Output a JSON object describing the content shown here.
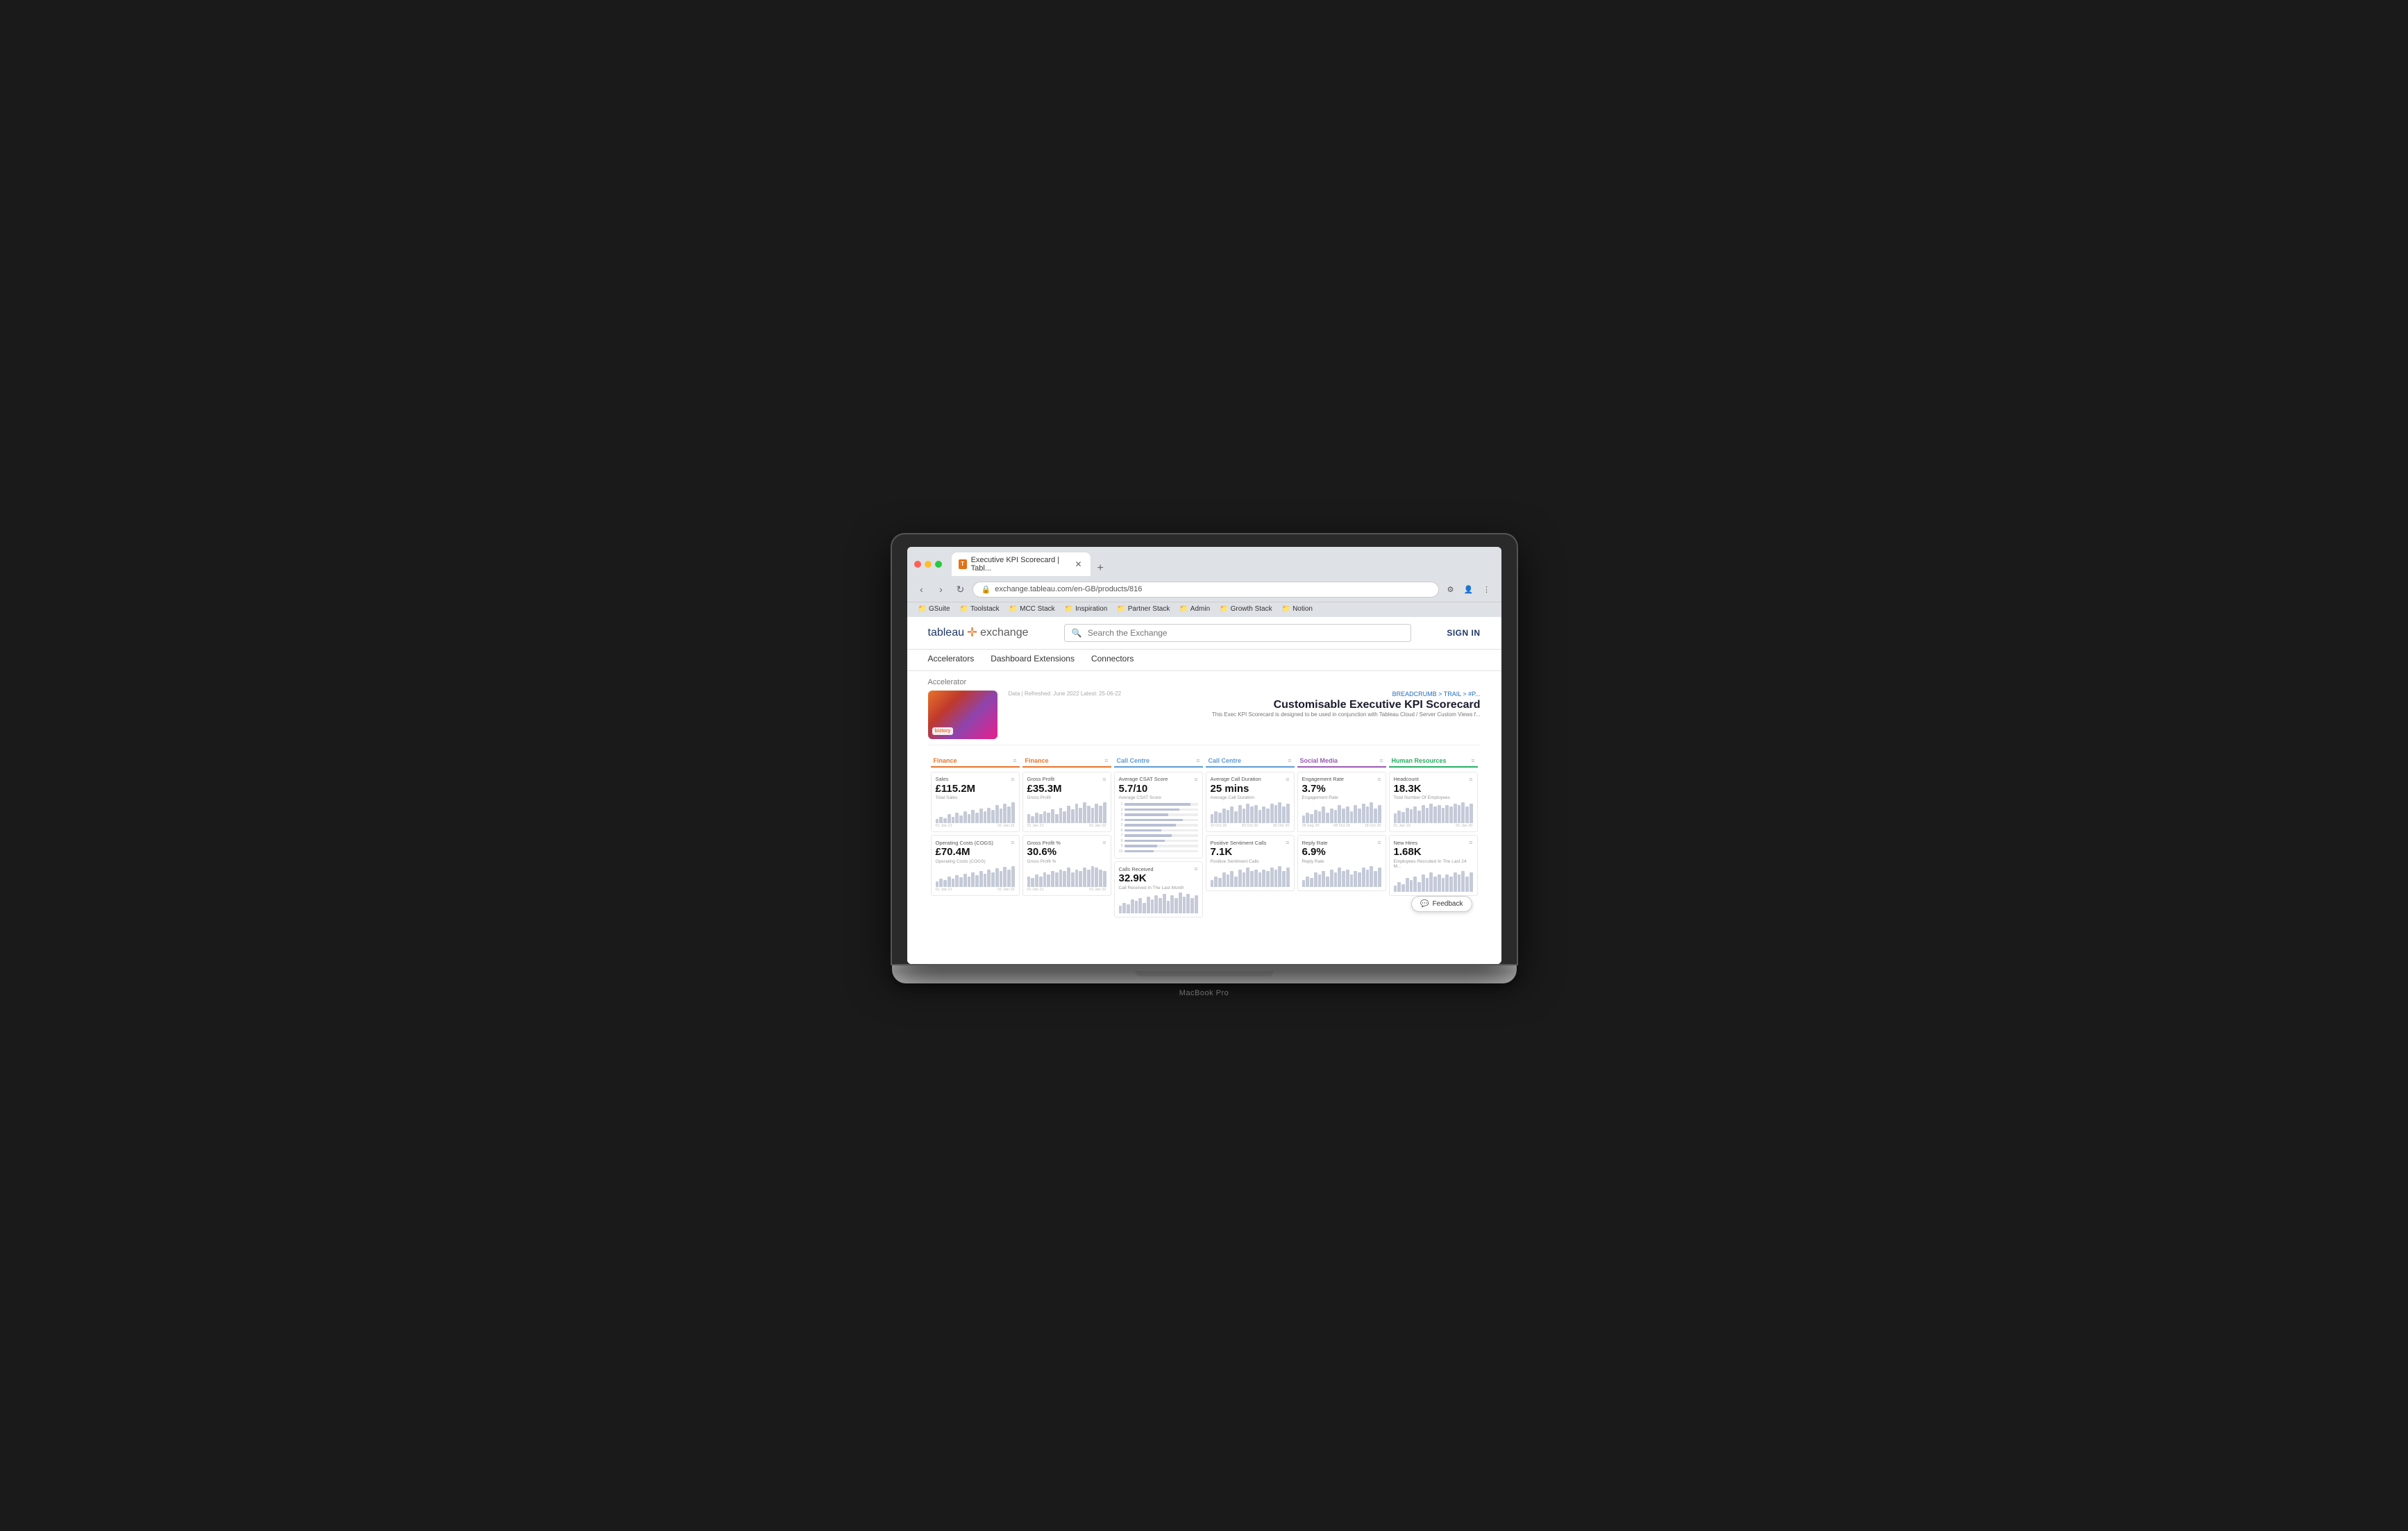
{
  "laptop": {
    "model": "MacBook Pro"
  },
  "browser": {
    "tab_title": "Executive KPI Scorecard | Tabl...",
    "url": "exchange.tableau.com/en-GB/products/816",
    "new_tab": "+",
    "nav": {
      "back": "‹",
      "forward": "›",
      "refresh": "↻"
    },
    "bookmarks": [
      {
        "label": "GSuite"
      },
      {
        "label": "Toolstack"
      },
      {
        "label": "MCC Stack"
      },
      {
        "label": "Inspiration"
      },
      {
        "label": "Partner Stack"
      },
      {
        "label": "Admin"
      },
      {
        "label": "Growth Stack"
      },
      {
        "label": "Notion"
      }
    ]
  },
  "tableau_exchange": {
    "logo_tableau": "tableau",
    "logo_cross": "✛",
    "logo_exchange": "exchange",
    "search_placeholder": "Search the Exchange",
    "sign_in": "SIGN IN",
    "nav_items": [
      "Accelerators",
      "Dashboard Extensions",
      "Connectors"
    ],
    "page_label": "Accelerator"
  },
  "product": {
    "data_refreshed": "Data | Refreshed: June 2022  Latest: 25-06-22",
    "badge": "biztory",
    "breadcrumb": "BREADCRUMB > TRAIL > #P...",
    "title": "Customisable Executive KPI Scorecard",
    "subtitle": "This Exec KPI Scorecard is designed to be used in conjunction with Tableau Cloud / Server Custom Views f..."
  },
  "sections": [
    {
      "id": "finance1",
      "label": "Finance",
      "color": "#e8742a",
      "cards": [
        {
          "title": "Sales",
          "value": "£115.2M",
          "sublabel": "Total Sales",
          "chart_type": "bars",
          "bars": [
            3,
            5,
            4,
            7,
            5,
            8,
            6,
            9,
            7,
            10,
            8,
            11,
            9,
            12,
            10,
            14,
            11,
            15,
            13,
            16
          ],
          "axis": [
            "01 Jan 21",
            "01 Jan 22"
          ]
        },
        {
          "title": "Operating Costs (COGS)",
          "value": "£70.4M",
          "sublabel": "Operating Costs (COGS)",
          "chart_type": "bars",
          "bars": [
            4,
            6,
            5,
            8,
            6,
            9,
            7,
            10,
            8,
            11,
            9,
            12,
            10,
            13,
            11,
            14,
            12,
            15,
            13,
            16
          ],
          "axis": [
            "01 Jan 21",
            "01 Jan 22"
          ]
        }
      ]
    },
    {
      "id": "finance2",
      "label": "Finance",
      "color": "#e8742a",
      "cards": [
        {
          "title": "Gross Profit",
          "value": "£35.3M",
          "sublabel": "Gross Profit",
          "chart_type": "bars",
          "bars": [
            5,
            4,
            6,
            5,
            7,
            6,
            8,
            5,
            9,
            7,
            10,
            8,
            11,
            9,
            12,
            10,
            9,
            11,
            10,
            12
          ],
          "axis": [
            "01 Jan 21",
            "01 Jan 22"
          ]
        },
        {
          "title": "Gross Profit %",
          "value": "30.6%",
          "sublabel": "Gross Profit %",
          "chart_type": "bars",
          "bars": [
            6,
            5,
            7,
            6,
            8,
            7,
            9,
            8,
            10,
            9,
            11,
            8,
            10,
            9,
            11,
            10,
            12,
            11,
            10,
            9
          ],
          "axis": [
            "01 Jan 21",
            "01 Jan 22"
          ]
        }
      ]
    },
    {
      "id": "callcentre1",
      "label": "Call Centre",
      "color": "#5b9bd5",
      "cards": [
        {
          "title": "Average CSAT Score",
          "value": "5.7/10",
          "sublabel": "Average CSAT Score",
          "chart_type": "hbars",
          "hbars": [
            90,
            75,
            60,
            80,
            70,
            50,
            65,
            55,
            45,
            40
          ],
          "hbar_labels": [
            "1",
            "2",
            "3",
            "4",
            "5",
            "6",
            "7",
            "8",
            "9",
            "10"
          ]
        },
        {
          "title": "Calls Received",
          "value": "32.9K",
          "sublabel": "Call Received In The Last Month",
          "chart_type": "bars",
          "bars": [
            5,
            7,
            6,
            9,
            8,
            10,
            7,
            11,
            9,
            12,
            10,
            13,
            8,
            12,
            10,
            14,
            11,
            13,
            10,
            12
          ],
          "axis": []
        }
      ]
    },
    {
      "id": "callcentre2",
      "label": "Call Centre",
      "color": "#5b9bd5",
      "cards": [
        {
          "title": "Average Call Duration",
          "value": "25 mins",
          "sublabel": "Average Call Duration",
          "chart_type": "bars",
          "bars": [
            6,
            8,
            7,
            10,
            9,
            11,
            8,
            12,
            10,
            13,
            11,
            12,
            9,
            11,
            10,
            13,
            12,
            14,
            11,
            13
          ],
          "axis": [
            "10 Oct 20",
            "20 Oct 20",
            "30 Oct 20"
          ]
        },
        {
          "title": "Positive Sentiment Calls",
          "value": "7.1K",
          "sublabel": "Positive Sentiment Calls",
          "chart_type": "bars",
          "bars": [
            4,
            6,
            5,
            8,
            7,
            9,
            6,
            10,
            8,
            11,
            9,
            10,
            8,
            10,
            9,
            11,
            10,
            12,
            9,
            11
          ],
          "axis": []
        }
      ]
    },
    {
      "id": "social",
      "label": "Social Media",
      "color": "#9b59b6",
      "cards": [
        {
          "title": "Engagement Rate",
          "value": "3.7%",
          "sublabel": "Engagement Rate",
          "chart_type": "bars",
          "bars": [
            5,
            7,
            6,
            9,
            8,
            11,
            7,
            10,
            9,
            12,
            10,
            11,
            8,
            12,
            10,
            13,
            11,
            14,
            10,
            12
          ],
          "axis": [
            "28 Sep 20",
            "08 Oct 20",
            "18 Oct 20"
          ]
        },
        {
          "title": "Reply Rate",
          "value": "6.9%",
          "sublabel": "Reply Rate",
          "chart_type": "bars",
          "bars": [
            4,
            6,
            5,
            8,
            7,
            9,
            6,
            10,
            8,
            11,
            9,
            10,
            7,
            9,
            8,
            11,
            10,
            12,
            9,
            11
          ],
          "axis": []
        }
      ]
    },
    {
      "id": "hr",
      "label": "Human Resources",
      "color": "#27ae60",
      "cards": [
        {
          "title": "Headcount",
          "value": "18.3K",
          "sublabel": "Total Number Of Employees",
          "chart_type": "bars",
          "bars": [
            7,
            9,
            8,
            11,
            10,
            12,
            9,
            13,
            11,
            14,
            12,
            13,
            11,
            13,
            12,
            14,
            13,
            15,
            12,
            14
          ],
          "axis": [
            "01 Jan 19",
            "01 Jan 20"
          ]
        },
        {
          "title": "New Hires",
          "value": "1.68K",
          "sublabel": "Employees Recruited In The Last 24 M...",
          "chart_type": "bars",
          "bars": [
            3,
            5,
            4,
            7,
            6,
            8,
            5,
            9,
            7,
            10,
            8,
            9,
            7,
            9,
            8,
            10,
            9,
            11,
            8,
            10
          ],
          "axis": []
        }
      ]
    }
  ],
  "feedback": {
    "label": "Feedback",
    "icon": "💬"
  }
}
